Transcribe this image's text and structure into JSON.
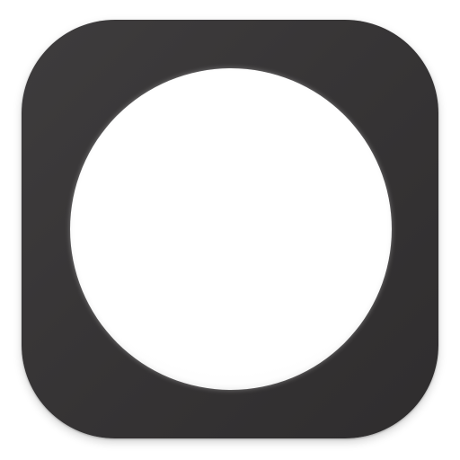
{
  "app_icon": {
    "icon_name": "circle-in-rounded-square-icon",
    "colors": {
      "tile": "#363435",
      "disc": "#ffffff",
      "background": "#ffffff"
    }
  }
}
